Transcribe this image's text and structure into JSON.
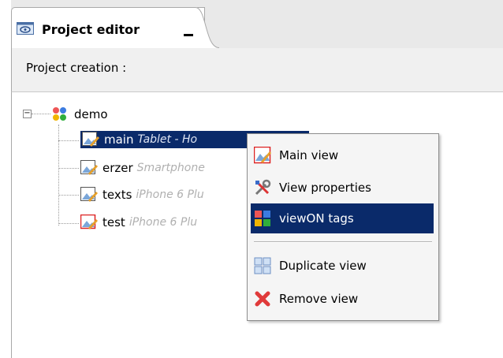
{
  "tab": {
    "title": "Project editor"
  },
  "section": {
    "label": "Project creation :"
  },
  "tree": {
    "root": {
      "label": "demo",
      "expander": "⊟"
    },
    "items": [
      {
        "name": "main",
        "device": "Tablet - Ho",
        "selected": true
      },
      {
        "name": "erzer",
        "device": "Smartphone",
        "selected": false
      },
      {
        "name": "texts",
        "device": "iPhone 6 Plu",
        "selected": false
      },
      {
        "name": "test",
        "device": "iPhone 6 Plu",
        "selected": false
      }
    ]
  },
  "context_menu": {
    "items": [
      {
        "label": "Main view",
        "icon": "main-view-icon"
      },
      {
        "label": "View properties",
        "icon": "tools-icon"
      },
      {
        "label": "viewON tags",
        "icon": "tags-icon",
        "active": true
      },
      {
        "label": "Duplicate view",
        "icon": "duplicate-icon"
      },
      {
        "label": "Remove view",
        "icon": "remove-x-icon"
      }
    ]
  },
  "colors": {
    "selection": "#0a2a6a",
    "device_text": "#b0b0b0",
    "menu_bg": "#f5f5f5"
  }
}
